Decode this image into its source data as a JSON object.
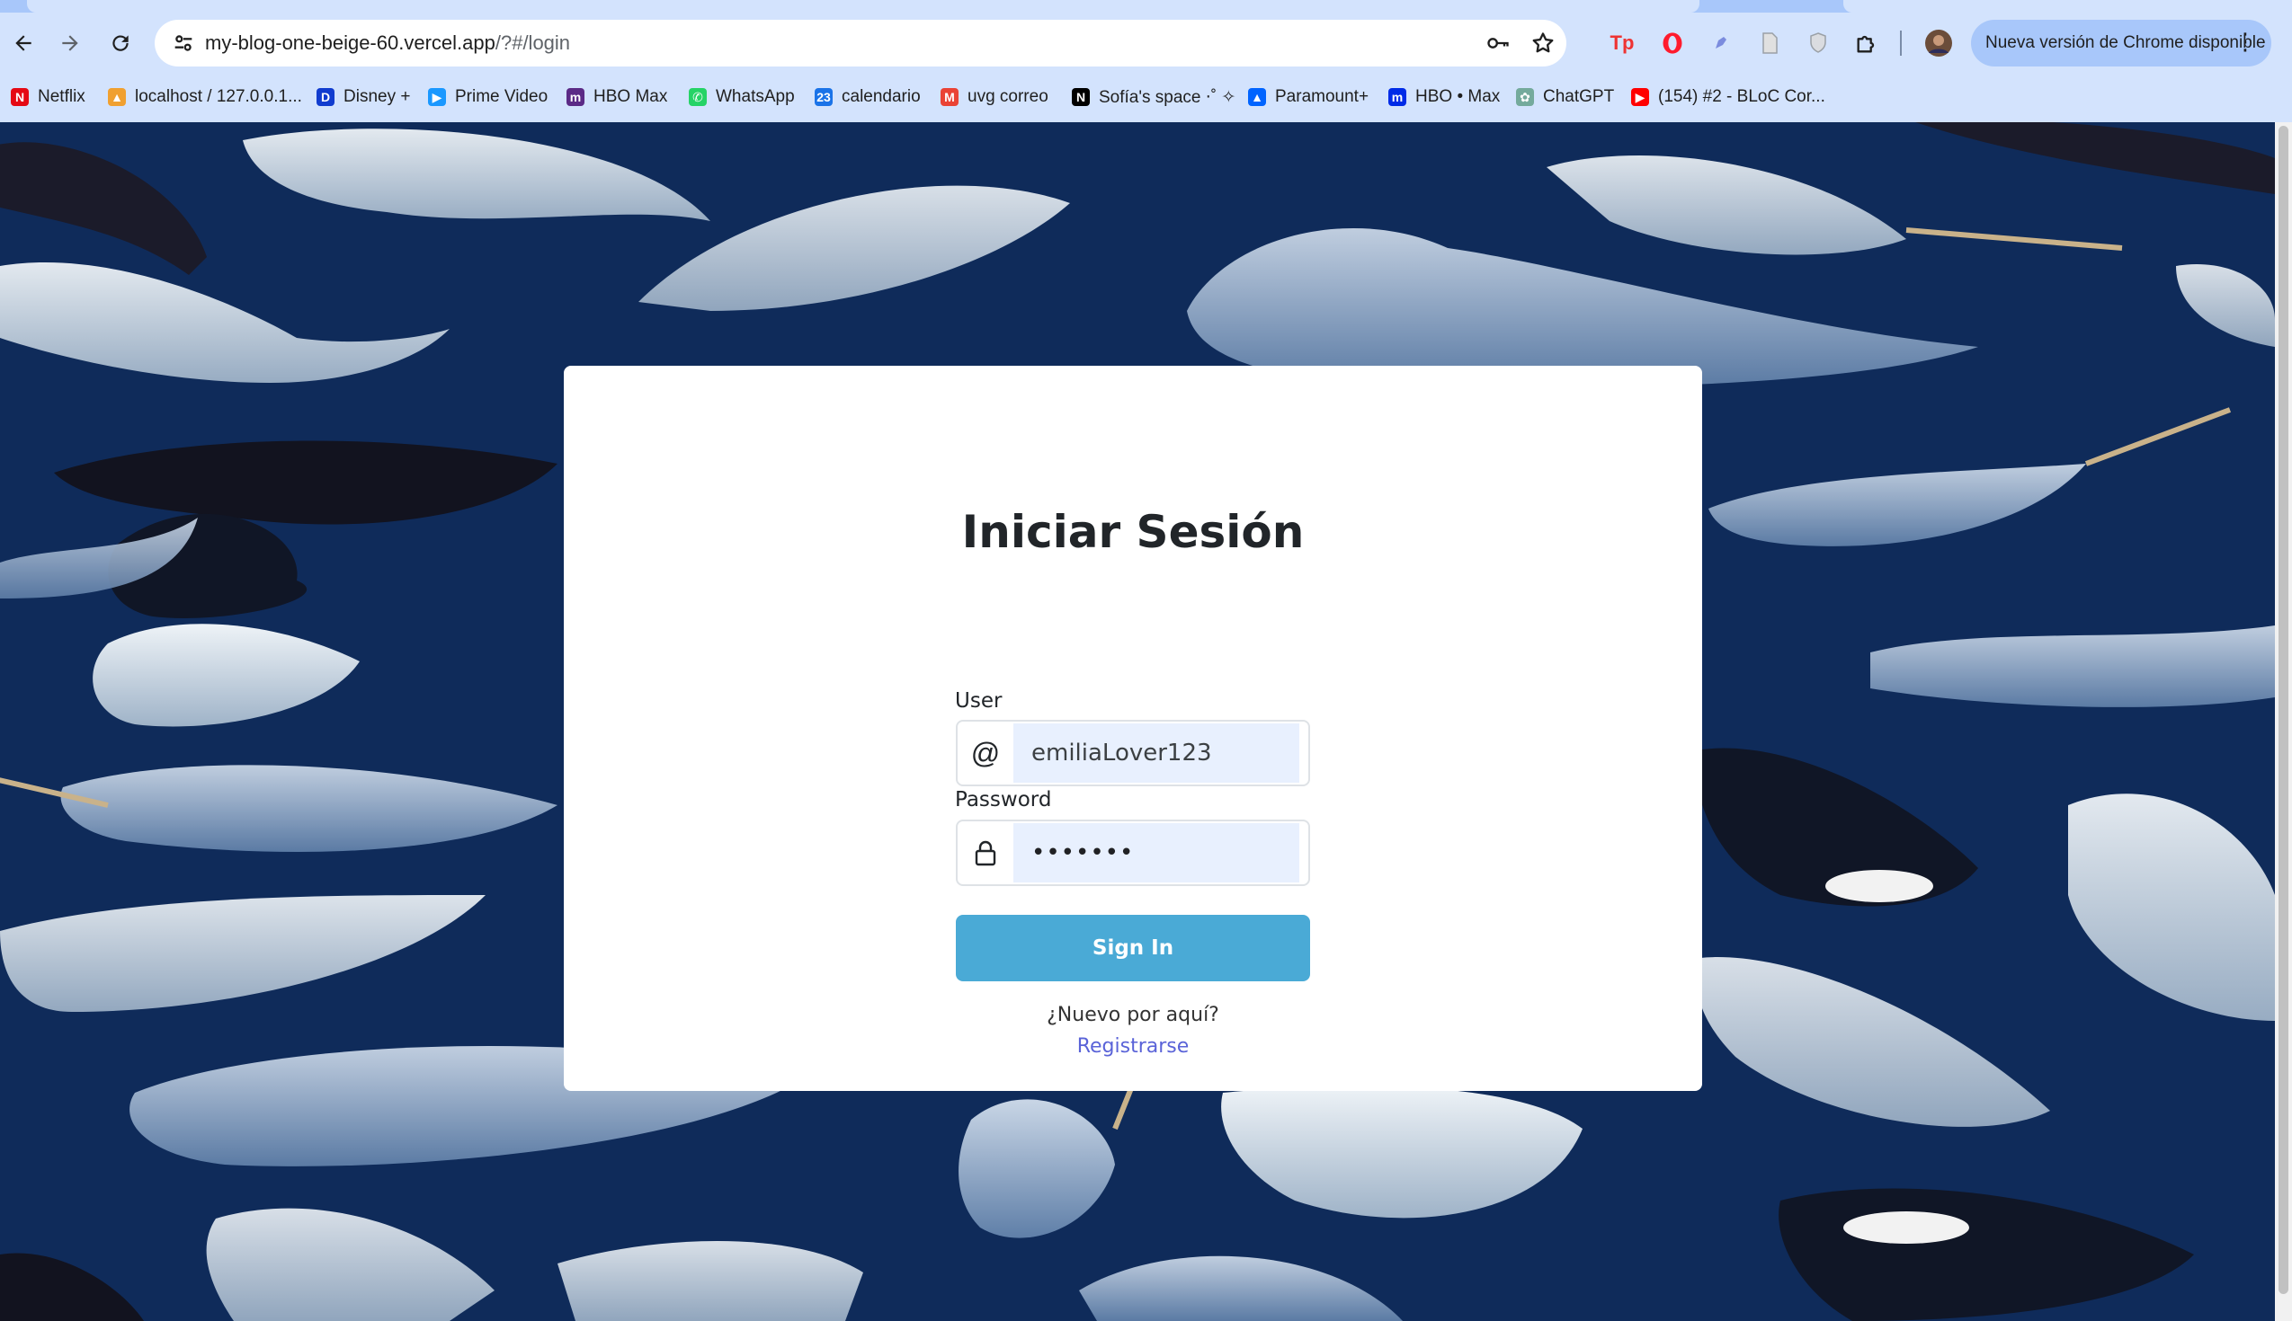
{
  "browser": {
    "url_host": "my-blog-one-beige-60.vercel.app",
    "url_path": "/?#/login",
    "update_label": "Nueva versión de Chrome disponible",
    "bookmarks": [
      {
        "label": "Netflix",
        "icon": "netflix-icon",
        "color": "#e50914",
        "glyph": "N"
      },
      {
        "label": "localhost / 127.0.0.1...",
        "icon": "phpmyadmin-icon",
        "color": "#f0a030",
        "glyph": "▲"
      },
      {
        "label": "Disney +",
        "icon": "disney-icon",
        "color": "#113ccf",
        "glyph": "D"
      },
      {
        "label": "Prime Video",
        "icon": "prime-video-icon",
        "color": "#1a98ff",
        "glyph": "▶"
      },
      {
        "label": "HBO Max",
        "icon": "hbo-max-icon",
        "color": "#5b2a86",
        "glyph": "m"
      },
      {
        "label": "WhatsApp",
        "icon": "whatsapp-icon",
        "color": "#25d366",
        "glyph": "✆"
      },
      {
        "label": "calendario",
        "icon": "calendar-icon",
        "color": "#1a73e8",
        "glyph": "23"
      },
      {
        "label": "uvg correo",
        "icon": "gmail-icon",
        "color": "#ea4335",
        "glyph": "M"
      },
      {
        "label": "Sofía's space ⋅˚ ✧",
        "icon": "notion-icon",
        "color": "#000000",
        "glyph": "N"
      },
      {
        "label": "Paramount+",
        "icon": "paramount-icon",
        "color": "#0064ff",
        "glyph": "▲"
      },
      {
        "label": "HBO • Max",
        "icon": "hbo-max-icon",
        "color": "#002be7",
        "glyph": "m"
      },
      {
        "label": "ChatGPT",
        "icon": "chatgpt-icon",
        "color": "#74aa9c",
        "glyph": "✿"
      },
      {
        "label": "(154) #2 - BLoC Cor...",
        "icon": "youtube-icon",
        "color": "#ff0000",
        "glyph": "▶"
      }
    ]
  },
  "login": {
    "title": "Iniciar Sesión",
    "user_label": "User",
    "user_value": "emiliaLover123",
    "user_prefix": "@",
    "password_label": "Password",
    "password_value": "•••••••",
    "sign_in_label": "Sign In",
    "new_here": "¿Nuevo por aquí?",
    "register_label": "Registrarse"
  },
  "colors": {
    "background": "#0f2b5a",
    "sign_in_button": "#4aaad6",
    "register_link": "#5a63d8",
    "input_fill": "#e8f0fe"
  }
}
